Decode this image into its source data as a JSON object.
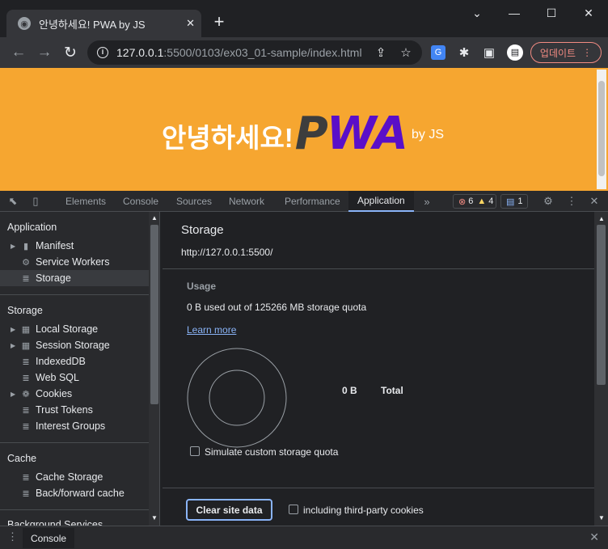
{
  "browser": {
    "tab_title": "안녕하세요! PWA by JS",
    "url_host": "127.0.0.1",
    "url_rest": ":5500/0103/ex03_01-sample/index.html",
    "update_label": "업데이트"
  },
  "page": {
    "greeting": "안녕하세요!",
    "logo_p": "P",
    "logo_w": "W",
    "logo_a": "A",
    "byline": "by JS",
    "background_color": "#f6a630"
  },
  "devtools": {
    "tabs": [
      "Elements",
      "Console",
      "Sources",
      "Network",
      "Performance",
      "Application"
    ],
    "active_tab": "Application",
    "error_count": "6",
    "warning_count": "4",
    "issue_count": "1",
    "sidebar": {
      "application_header": "Application",
      "application_items": [
        "Manifest",
        "Service Workers",
        "Storage"
      ],
      "storage_header": "Storage",
      "storage_items": [
        "Local Storage",
        "Session Storage",
        "IndexedDB",
        "Web SQL",
        "Cookies",
        "Trust Tokens",
        "Interest Groups"
      ],
      "cache_header": "Cache",
      "cache_items": [
        "Cache Storage",
        "Back/forward cache"
      ],
      "background_header": "Background Services"
    },
    "storage_panel": {
      "title": "Storage",
      "origin": "http://127.0.0.1:5500/",
      "usage_header": "Usage",
      "quota_text": "0 B used out of 125266 MB storage quota",
      "learn_more": "Learn more",
      "total_value": "0 B",
      "total_label": "Total",
      "simulate_label": "Simulate custom storage quota",
      "clear_button": "Clear site data",
      "third_party_label": "including third-party cookies"
    },
    "drawer_tab": "Console"
  },
  "colors": {
    "accent": "#8ab4f8",
    "update_red": "#f28b82"
  }
}
